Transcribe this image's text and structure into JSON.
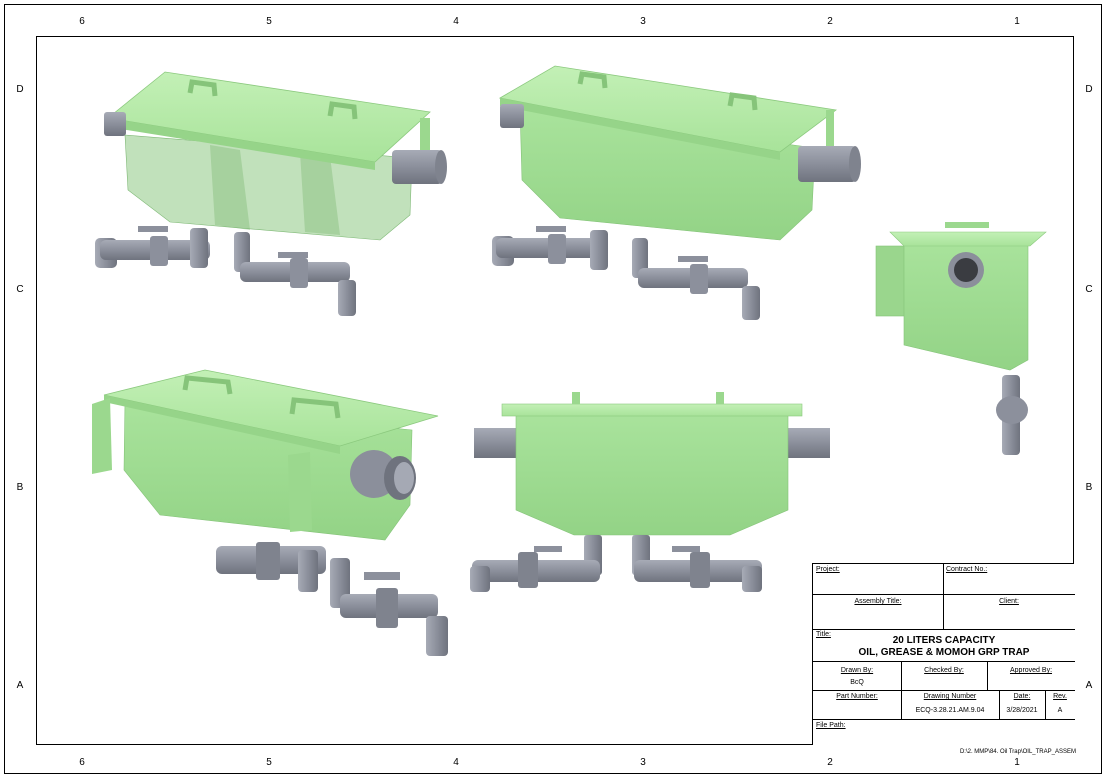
{
  "sheet": {
    "zones_top": [
      "6",
      "5",
      "4",
      "3",
      "2",
      "1"
    ],
    "zones_bottom": [
      "6",
      "5",
      "4",
      "3",
      "2",
      "1"
    ],
    "zones_left": [
      "D",
      "C",
      "B",
      "A"
    ],
    "zones_right": [
      "D",
      "C",
      "B",
      "A"
    ]
  },
  "title_block": {
    "project_label": "Project:",
    "contract_label": "Contract No.:",
    "assembly_title_label": "Assembly Title:",
    "client_label": "Client:",
    "title_label": "Title:",
    "title_line1": "20 LITERS CAPACITY",
    "title_line2": "OIL, GREASE & MOMOH GRP TRAP",
    "drawn_by_label": "Drawn By:",
    "drawn_by_value": "BcQ",
    "checked_by_label": "Checked By:",
    "approved_by_label": "Approved By:",
    "part_number_label": "Part Number:",
    "drawing_number_label": "Drawing Number",
    "drawing_number_value": "ECQ-3.28.21.AM.9.04",
    "date_label": "Date:",
    "date_value": "3/28/2021",
    "rev_label": "Rev.",
    "rev_value": "A",
    "file_path_label": "File Path:"
  },
  "file_path": "D:\\2. MMP\\84. Oil Trap\\OIL_TRAP_ASSEM",
  "colors": {
    "tank": "#a8e29a",
    "tank_dark": "#8fcf83",
    "tank_top": "#b9ec ab",
    "pipe": "#9397a3",
    "pipe_dark": "#7c808c"
  }
}
